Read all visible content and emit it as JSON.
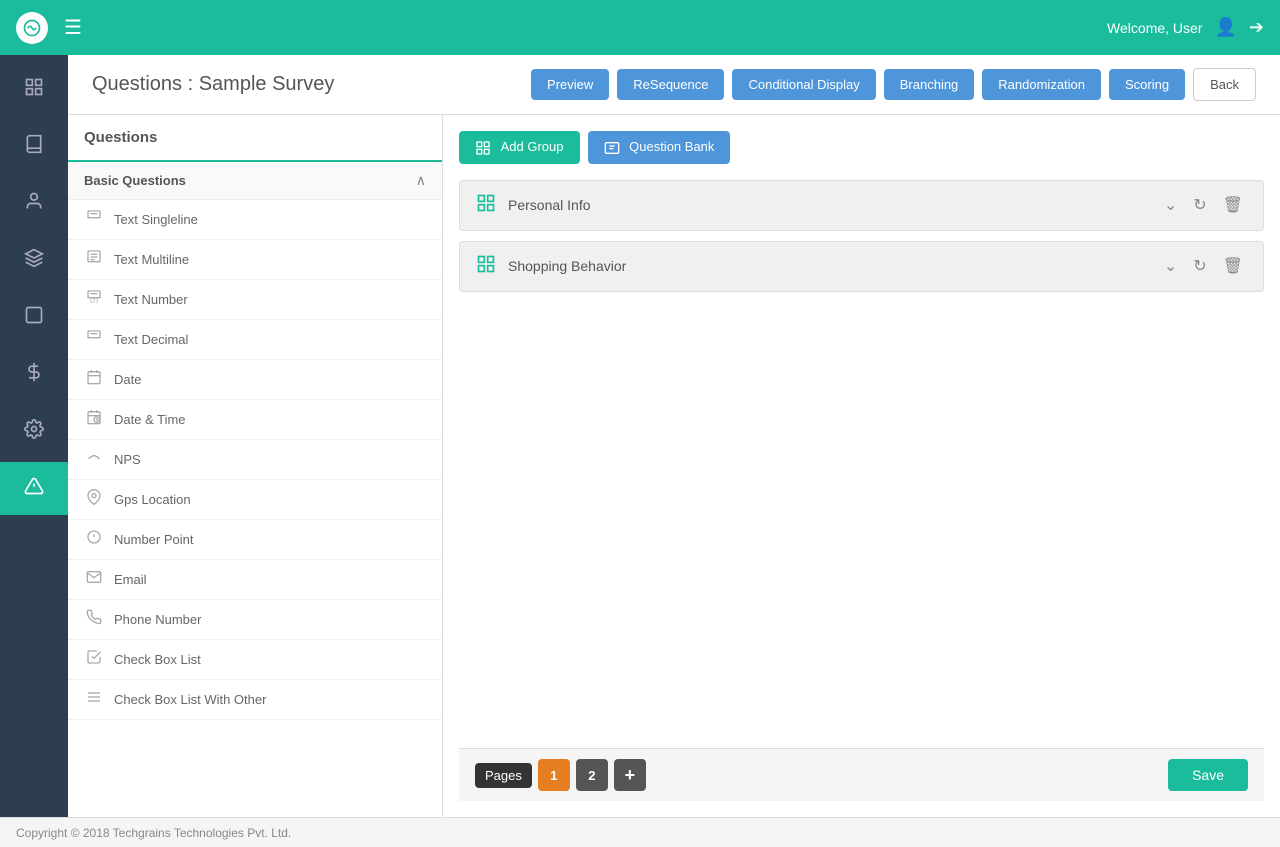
{
  "topNav": {
    "logoAlt": "logo",
    "welcomeText": "Welcome, User",
    "hamburgerLabel": "menu"
  },
  "header": {
    "title": "Questions : Sample Survey",
    "buttons": {
      "preview": "Preview",
      "resequence": "ReSequence",
      "conditionalDisplay": "Conditional Display",
      "branching": "Branching",
      "randomization": "Randomization",
      "scoring": "Scoring",
      "back": "Back"
    }
  },
  "sidebarIcons": [
    {
      "name": "dashboard-icon",
      "symbol": "⊞"
    },
    {
      "name": "book-icon",
      "symbol": "📖"
    },
    {
      "name": "user-icon",
      "symbol": "👤"
    },
    {
      "name": "layers-icon",
      "symbol": "⧉"
    },
    {
      "name": "file-icon",
      "symbol": "☐"
    },
    {
      "name": "dollar-icon",
      "symbol": "$"
    },
    {
      "name": "settings-icon",
      "symbol": "⚙"
    },
    {
      "name": "alert-icon",
      "symbol": "⚠",
      "active": true
    }
  ],
  "questionsPanel": {
    "title": "Questions",
    "basicQuestionsTitle": "Basic Questions",
    "items": [
      {
        "label": "Text Singleline",
        "icon": "☐"
      },
      {
        "label": "Text Multiline",
        "icon": "☐"
      },
      {
        "label": "Text Number",
        "icon": "☐"
      },
      {
        "label": "Text Decimal",
        "icon": "☐"
      },
      {
        "label": "Date",
        "icon": "📅"
      },
      {
        "label": "Date & Time",
        "icon": "📅"
      },
      {
        "label": "NPS",
        "icon": "⌒"
      },
      {
        "label": "Gps Location",
        "icon": "📍"
      },
      {
        "label": "Number Point",
        "icon": "ℹ"
      },
      {
        "label": "Email",
        "icon": "✉"
      },
      {
        "label": "Phone Number",
        "icon": "📞"
      },
      {
        "label": "Check Box List",
        "icon": "☑"
      },
      {
        "label": "Check Box List With Other",
        "icon": "☰"
      }
    ]
  },
  "surveyArea": {
    "addGroupLabel": "Add Group",
    "questionBankLabel": "Question Bank",
    "groups": [
      {
        "name": "Personal Info"
      },
      {
        "name": "Shopping Behavior"
      }
    ]
  },
  "pagesBar": {
    "pagesLabel": "Pages",
    "pages": [
      "1",
      "2"
    ],
    "activePage": "1",
    "addPage": "+",
    "saveLabel": "Save"
  },
  "footer": {
    "text": "Copyright © 2018 Techgrains Technologies Pvt. Ltd."
  }
}
